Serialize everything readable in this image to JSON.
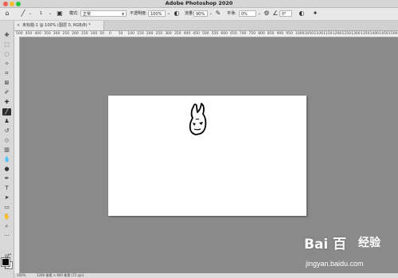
{
  "app": {
    "title": "Adobe Photoshop 2020"
  },
  "options_bar": {
    "brush_size": "1",
    "mode_label": "模式:",
    "mode_value": "正常",
    "opacity_label": "不透明度:",
    "opacity_value": "100%",
    "flow_label": "流量:",
    "flow_value": "90%",
    "smoothing_label": "平滑:",
    "smoothing_value": "0%",
    "angle_value": "0°"
  },
  "document_tab": {
    "title": "未标题-1 @ 100% (图层 0, RGB/8) *"
  },
  "ruler_labels": [
    "500",
    "450",
    "400",
    "350",
    "300",
    "250",
    "200",
    "150",
    "100",
    "50",
    "0",
    "50",
    "100",
    "150",
    "200",
    "250",
    "300",
    "350",
    "400",
    "450",
    "500",
    "550",
    "600",
    "650",
    "700",
    "750",
    "800",
    "850",
    "900",
    "950",
    "1000",
    "1050",
    "1100",
    "1150",
    "1200",
    "1250",
    "1300",
    "1350",
    "1400",
    "1450",
    "1500"
  ],
  "statusbar": {
    "zoom": "100%",
    "doc_info": "1280 像素 × 800 像素 (72 ppi)"
  },
  "watermark": {
    "logo": "Bai 百",
    "cn": "经验",
    "url": "jingyan.baidu.com"
  },
  "colors": {
    "foreground": "#000000",
    "background": "#ffffff",
    "canvas_bg": "#8a8a8a"
  }
}
